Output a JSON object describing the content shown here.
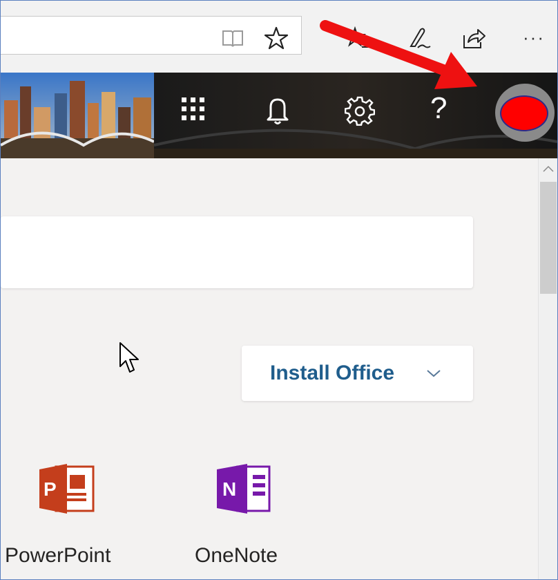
{
  "browser": {
    "toolbar_icons": [
      "reading-view-icon",
      "favorite-star-icon",
      "favorites-icon",
      "pen-icon",
      "share-icon"
    ],
    "more_label": "···"
  },
  "header": {
    "icons": [
      "app-launcher-icon",
      "bell-icon",
      "gear-icon",
      "help-icon"
    ],
    "help_label": "?",
    "avatar_color": "#ff0000"
  },
  "main": {
    "install_office_label": "Install Office",
    "apps": [
      {
        "name": "PowerPoint",
        "letter": "P",
        "color": "#c43e1c"
      },
      {
        "name": "OneNote",
        "letter": "N",
        "color": "#7719aa"
      }
    ]
  },
  "annotation": {
    "arrow_color": "#ee1111"
  }
}
